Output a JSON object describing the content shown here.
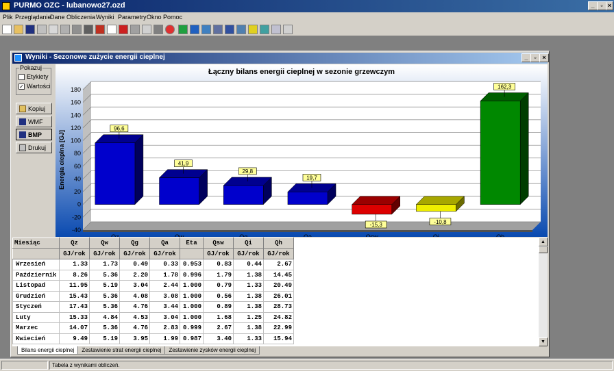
{
  "app": {
    "title": "PURMO OZC - lubanowo27.ozd",
    "menu": [
      "Plik",
      "Przeglądanie",
      "Dane",
      "Obliczenia",
      "Wyniki",
      "Parametry",
      "Okno",
      "Pomoc"
    ]
  },
  "window": {
    "title": "Wyniki - Sezonowe zużycie energii cieplnej"
  },
  "panel": {
    "group_label": "Pokazuj",
    "checkbox_labels": "Etykiety",
    "checkbox_values": "Wartości",
    "labels_checked": false,
    "values_checked": true,
    "btn_copy": "Kopiuj",
    "btn_wmf": "WMF",
    "btn_bmp": "BMP",
    "btn_print": "Drukuj"
  },
  "chart_data": {
    "type": "bar",
    "title": "Łączny bilans energii cieplnej w sezonie grzewczym",
    "ylabel": "Energia cieplna [GJ]",
    "xlabel": "",
    "ylim": [
      -40,
      180
    ],
    "yticks": [
      -40,
      -20,
      0,
      20,
      40,
      60,
      80,
      100,
      120,
      140,
      160,
      180
    ],
    "grid": true,
    "categories": [
      "Qz",
      "Qw",
      "Qg",
      "Qa",
      "Qsw",
      "Qi",
      "Qh"
    ],
    "values": [
      96.6,
      41.9,
      29.8,
      19.7,
      -15.3,
      -10.8,
      162.3
    ],
    "value_labels": [
      "96,6",
      "41,9",
      "29,8",
      "19,7",
      "-15,3",
      "-10,8",
      "162,3"
    ],
    "colors": [
      "#0000cc",
      "#0000cc",
      "#0000cc",
      "#0000cc",
      "#dd0000",
      "#eeee00",
      "#008800"
    ]
  },
  "table": {
    "columns": [
      "Miesiąc",
      "Qz",
      "Qw",
      "Qg",
      "Qa",
      "Eta",
      "Qsw",
      "Qi",
      "Qh"
    ],
    "units": [
      "",
      "GJ/rok",
      "GJ/rok",
      "GJ/rok",
      "GJ/rok",
      "",
      "GJ/rok",
      "GJ/rok",
      "GJ/rok"
    ],
    "rows": [
      [
        "Wrzesień",
        "1.33",
        "1.73",
        "0.49",
        "0.33",
        "0.953",
        "0.83",
        "0.44",
        "2.67"
      ],
      [
        "Październik",
        "8.26",
        "5.36",
        "2.20",
        "1.78",
        "0.996",
        "1.79",
        "1.38",
        "14.45"
      ],
      [
        "Listopad",
        "11.95",
        "5.19",
        "3.04",
        "2.44",
        "1.000",
        "0.79",
        "1.33",
        "20.49"
      ],
      [
        "Grudzień",
        "15.43",
        "5.36",
        "4.08",
        "3.08",
        "1.000",
        "0.56",
        "1.38",
        "26.01"
      ],
      [
        "Styczeń",
        "17.43",
        "5.36",
        "4.76",
        "3.44",
        "1.000",
        "0.89",
        "1.38",
        "28.73"
      ],
      [
        "Luty",
        "15.33",
        "4.84",
        "4.53",
        "3.04",
        "1.000",
        "1.68",
        "1.25",
        "24.82"
      ],
      [
        "Marzec",
        "14.07",
        "5.36",
        "4.76",
        "2.83",
        "0.999",
        "2.67",
        "1.38",
        "22.99"
      ],
      [
        "Kwiecień",
        "9.49",
        "5.19",
        "3.95",
        "1.99",
        "0.987",
        "3.40",
        "1.33",
        "15.94"
      ]
    ]
  },
  "tabs": [
    "Bilans energii cieplnej",
    "Zestawienie strat energii cieplnej",
    "Zestawienie zysków energii cieplnej"
  ],
  "status": {
    "text": "Tabela z wynikami obliczeń."
  }
}
